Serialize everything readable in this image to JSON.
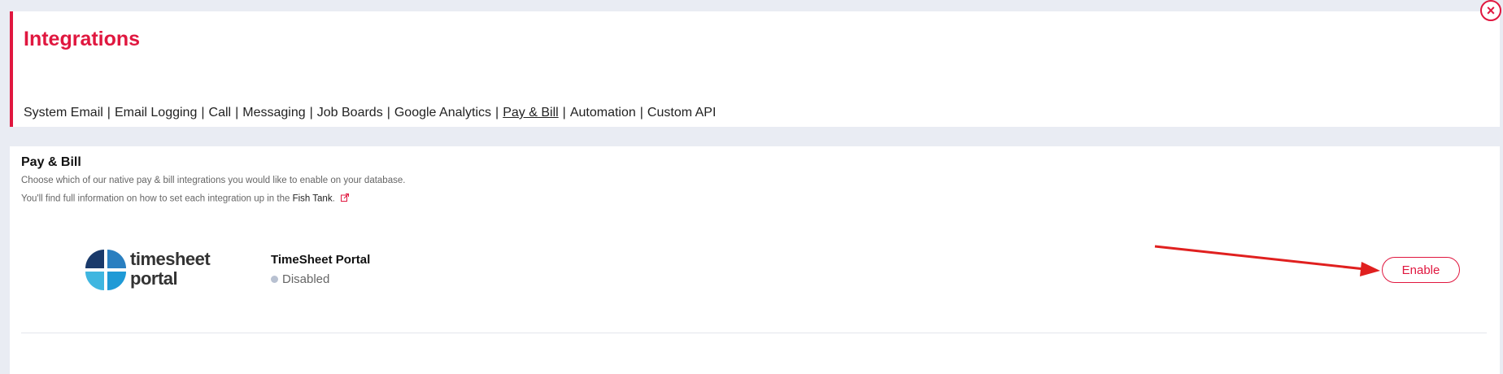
{
  "header": {
    "title": "Integrations",
    "nav": [
      {
        "label": "System Email",
        "active": false
      },
      {
        "label": "Email Logging",
        "active": false
      },
      {
        "label": "Call",
        "active": false
      },
      {
        "label": "Messaging",
        "active": false
      },
      {
        "label": "Job Boards",
        "active": false
      },
      {
        "label": "Google Analytics",
        "active": false
      },
      {
        "label": "Pay & Bill",
        "active": true
      },
      {
        "label": "Automation",
        "active": false
      },
      {
        "label": "Custom API",
        "active": false
      }
    ],
    "nav_separator": "|",
    "close_glyph": "×"
  },
  "section": {
    "title": "Pay & Bill",
    "description": "Choose which of our native pay & bill integrations you would like to enable on your database.",
    "info_prefix": "You'll find full information on how to set each integration up in the",
    "info_link": "Fish Tank",
    "info_suffix": "."
  },
  "integration": {
    "logo_line1": "timesheet",
    "logo_line2": "portal",
    "name": "TimeSheet Portal",
    "status": "Disabled",
    "enable_label": "Enable"
  },
  "colors": {
    "accent": "#e0173f",
    "status_disabled": "#b8c1d1"
  }
}
